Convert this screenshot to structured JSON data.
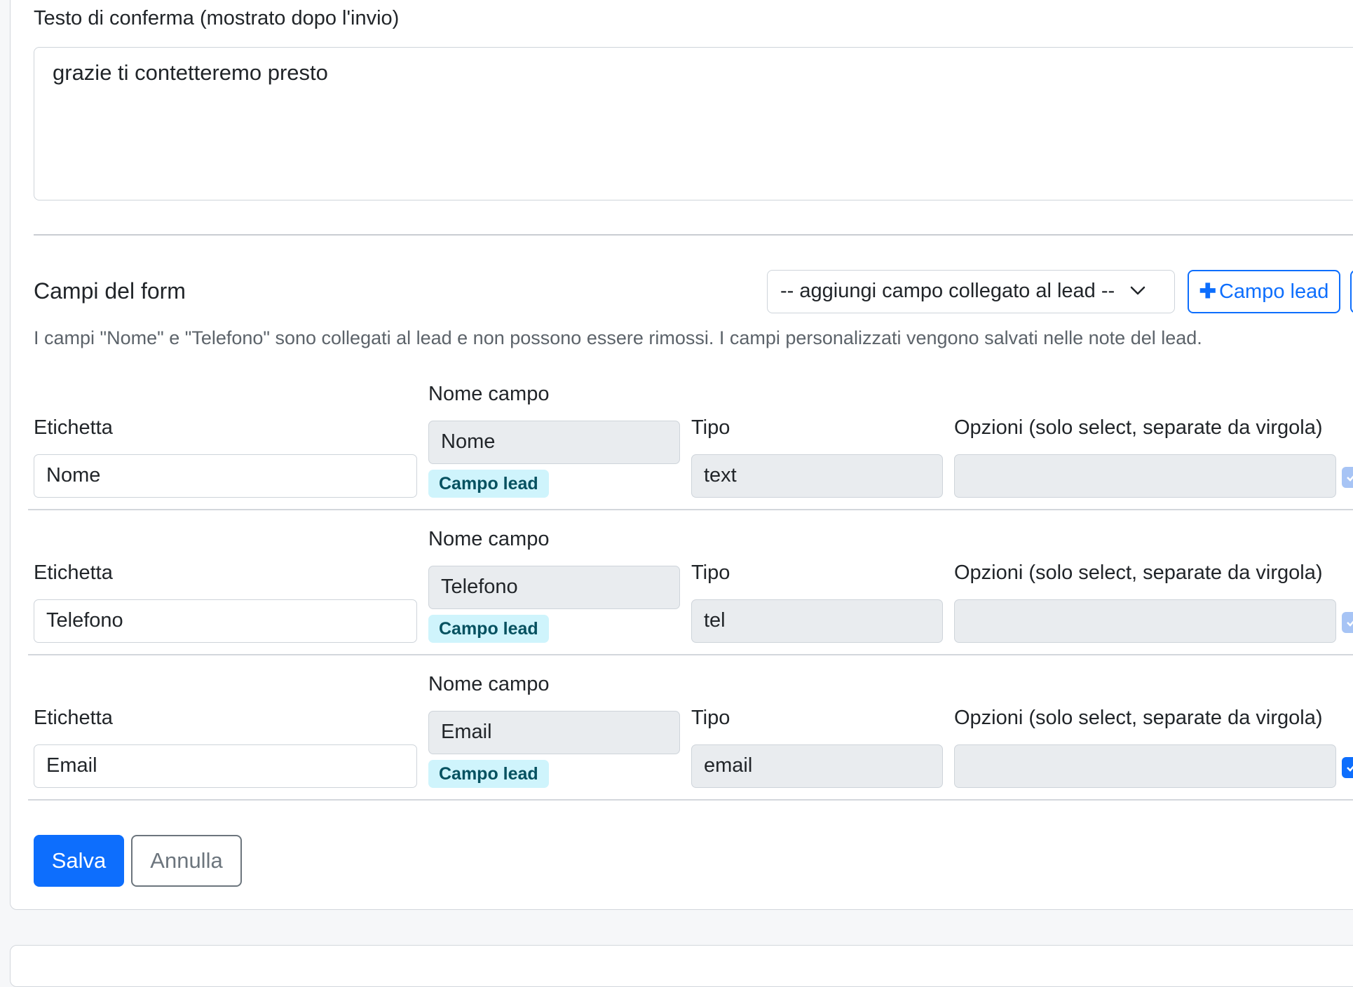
{
  "confirmation": {
    "label": "Testo di conferma (mostrato dopo l'invio)",
    "value": "grazie ti contetteremo presto"
  },
  "fields_section": {
    "title": "Campi del form",
    "select_placeholder": "-- aggiungi campo collegato al lead --",
    "add_button_label": "Campo lead",
    "help_text": "I campi \"Nome\" e \"Telefono\" sono collegati al lead e non possono essere rimossi. I campi personalizzati vengono salvati nelle note del lead."
  },
  "columns": {
    "label": "Etichetta",
    "field_name": "Nome campo",
    "type": "Tipo",
    "options": "Opzioni (solo select, separate da virgola)"
  },
  "fields": [
    {
      "label": "Nome",
      "field_name": "Nome",
      "badge": "Campo lead",
      "type": "text",
      "options": "",
      "checked": true
    },
    {
      "label": "Telefono",
      "field_name": "Telefono",
      "badge": "Campo lead",
      "type": "tel",
      "options": "",
      "checked": true
    },
    {
      "label": "Email",
      "field_name": "Email",
      "badge": "Campo lead",
      "type": "email",
      "options": "",
      "checked": true
    }
  ],
  "actions": {
    "save": "Salva",
    "cancel": "Annulla"
  },
  "colors": {
    "primary": "#0d6efd",
    "badge_bg": "#cff4fc",
    "badge_text": "#055160",
    "readonly_bg": "#e9ecef"
  }
}
